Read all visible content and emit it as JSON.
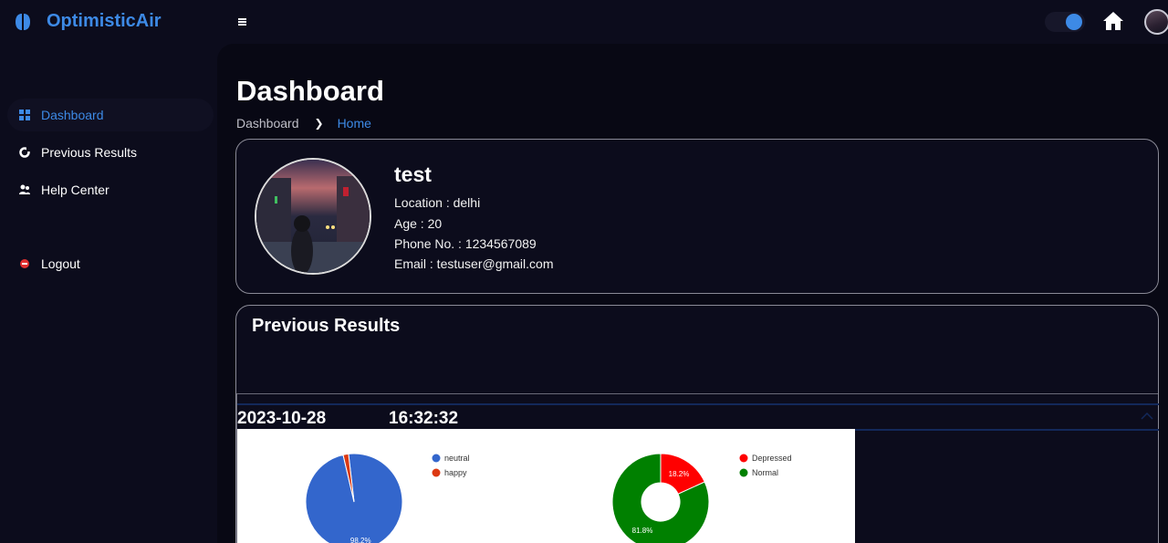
{
  "app": {
    "name": "OptimisticAir"
  },
  "topbar": {
    "theme_toggle_on": true
  },
  "sidebar": {
    "items": [
      {
        "label": "Dashboard",
        "active": true
      },
      {
        "label": "Previous Results",
        "active": false
      },
      {
        "label": "Help Center",
        "active": false
      },
      {
        "label": "Logout",
        "active": false
      }
    ]
  },
  "page": {
    "title": "Dashboard",
    "breadcrumb": [
      "Dashboard",
      "Home"
    ]
  },
  "profile": {
    "name": "test",
    "location": "Location : delhi",
    "age": "Age : 20",
    "phone": "Phone No. : 1234567089",
    "email": "Email : testuser@gmail.com"
  },
  "results": {
    "title": "Previous Results",
    "entries": [
      {
        "date": "2023-10-28",
        "time": "16:32:32",
        "expanded": true
      }
    ]
  },
  "colors": {
    "accent": "#3d8ae6",
    "neutral": "#3366cc",
    "happy": "#dc3912",
    "depressed": "#ff0000",
    "normal": "#008000"
  },
  "chart_data": [
    {
      "type": "pie",
      "categories": [
        "neutral",
        "happy"
      ],
      "values": [
        98.2,
        1.8
      ],
      "labels": [
        "98.2%",
        ""
      ]
    },
    {
      "type": "pie",
      "variant": "donut",
      "categories": [
        "Depressed",
        "Normal"
      ],
      "values": [
        18.2,
        81.8
      ],
      "labels": [
        "18.2%",
        "81.8%"
      ]
    }
  ]
}
